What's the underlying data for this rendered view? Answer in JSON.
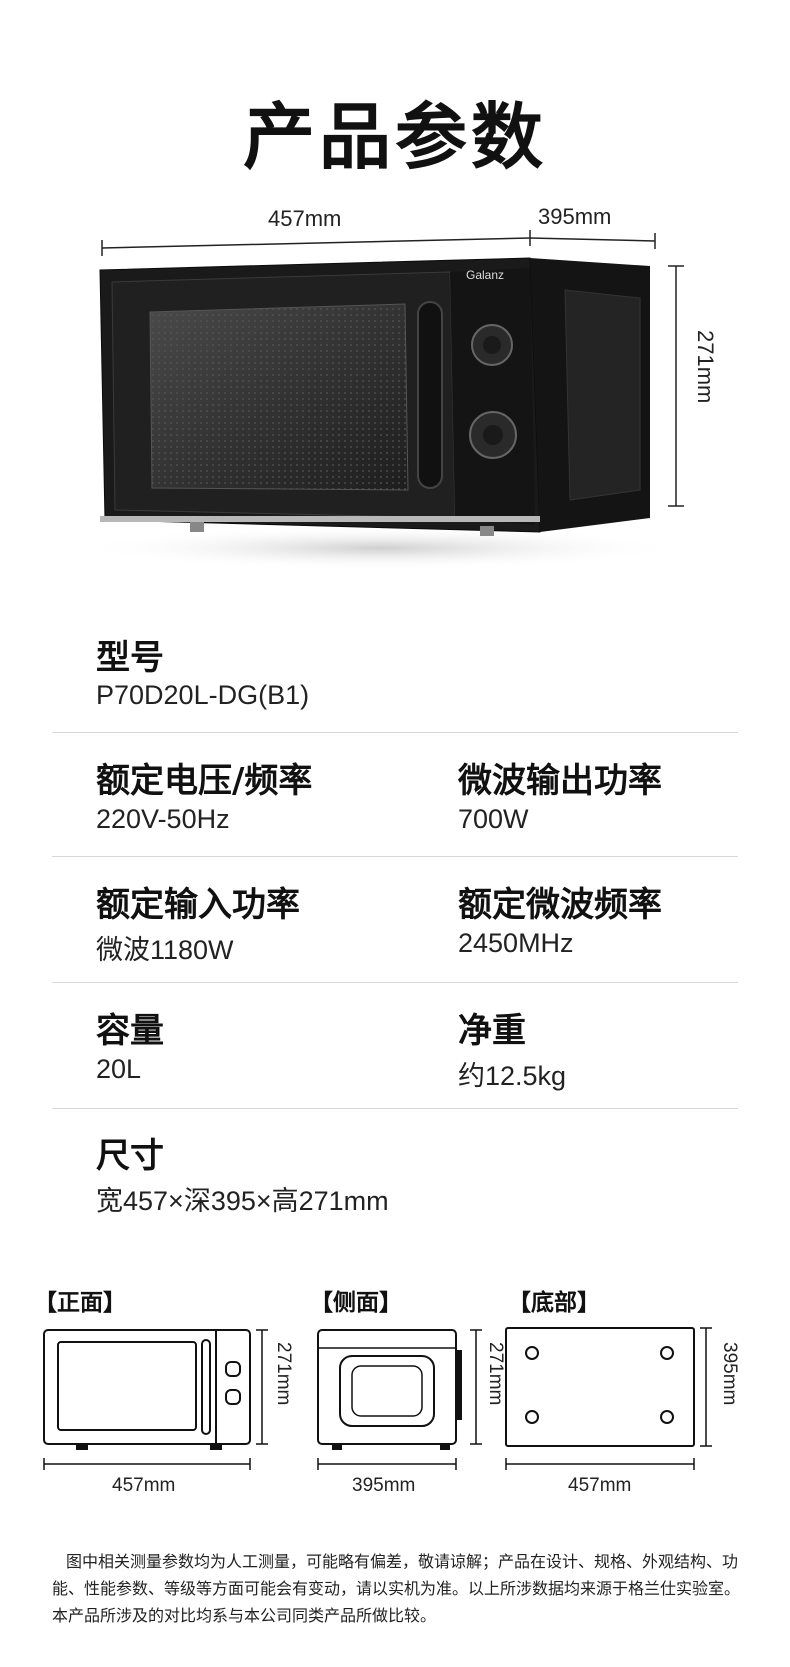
{
  "page_title": "产品参数",
  "product_dims": {
    "width": "457mm",
    "depth": "395mm",
    "height": "271mm"
  },
  "brand": "Galanz",
  "specs": {
    "model": {
      "label": "型号",
      "value": "P70D20L-DG(B1)"
    },
    "voltage": {
      "label": "额定电压/频率",
      "value": "220V-50Hz"
    },
    "output_power": {
      "label": "微波输出功率",
      "value": "700W"
    },
    "input_power": {
      "label": "额定输入功率",
      "value": "微波1180W"
    },
    "frequency": {
      "label": "额定微波频率",
      "value": "2450MHz"
    },
    "capacity": {
      "label": "容量",
      "value": "20L"
    },
    "net_weight": {
      "label": "净重",
      "value": "约12.5kg"
    },
    "size": {
      "label": "尺寸",
      "value": "宽457×深395×高271mm"
    }
  },
  "views": {
    "front": {
      "title": "【正面】",
      "width": "457mm",
      "height": "271mm"
    },
    "side": {
      "title": "【侧面】",
      "width": "395mm",
      "height": "271mm"
    },
    "bottom": {
      "title": "【底部】",
      "width": "457mm",
      "height": "395mm"
    }
  },
  "disclaimer": "图中相关测量参数均为人工测量，可能略有偏差，敬请谅解；产品在设计、规格、外观结构、功能、性能参数、等级等方面可能会有变动，请以实机为准。以上所涉数据均来源于格兰仕实验室。本产品所涉及的对比均系与本公司同类产品所做比较。"
}
